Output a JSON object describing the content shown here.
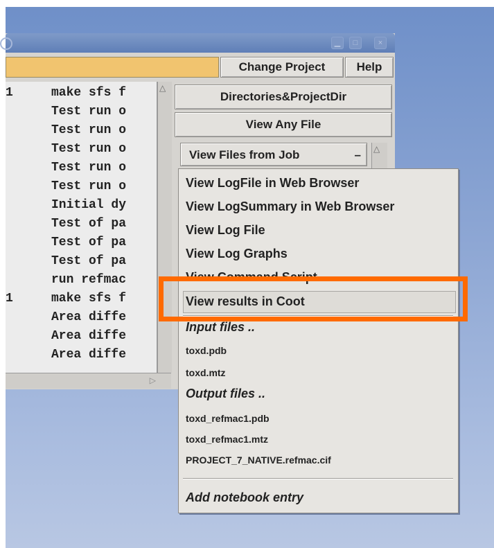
{
  "toolbar": {
    "change_project": "Change Project",
    "help": "Help",
    "directories": "Directories&ProjectDir",
    "view_any_file": "View Any File",
    "view_files_from_job": "View Files from Job",
    "dropdown_glyph": "–"
  },
  "job_list": [
    {
      "num": "1",
      "text": "make sfs f"
    },
    {
      "num": "",
      "text": "Test run o"
    },
    {
      "num": "",
      "text": "Test run o"
    },
    {
      "num": "",
      "text": "Test run o"
    },
    {
      "num": "",
      "text": "Test run o"
    },
    {
      "num": "",
      "text": "Test run o"
    },
    {
      "num": "",
      "text": "Initial dy"
    },
    {
      "num": "",
      "text": "Test of pa"
    },
    {
      "num": "",
      "text": "Test of pa"
    },
    {
      "num": "",
      "text": "Test of pa"
    },
    {
      "num": "",
      "text": "run refmac"
    },
    {
      "num": "1",
      "text": "make sfs f"
    },
    {
      "num": "",
      "text": "Area diffe"
    },
    {
      "num": "",
      "text": "Area diffe"
    },
    {
      "num": "",
      "text": "Area diffe"
    }
  ],
  "menu": {
    "view_logfile_web": "View LogFile in Web Browser",
    "view_logsummary_web": "View LogSummary in Web Browser",
    "view_log_file": "View Log File",
    "view_log_graphs": "View Log Graphs",
    "view_command_script": "View Command Script",
    "view_results_coot": "View results in Coot",
    "input_files_header": "Input files ..",
    "input_files": [
      "toxd.pdb",
      "toxd.mtz"
    ],
    "output_files_header": "Output files ..",
    "output_files": [
      "toxd_refmac1.pdb",
      "toxd_refmac1.mtz",
      "PROJECT_7_NATIVE.refmac.cif"
    ],
    "add_notebook": "Add notebook entry"
  },
  "colors": {
    "highlight": "#ff6a00",
    "project_field": "#f1c46f"
  }
}
